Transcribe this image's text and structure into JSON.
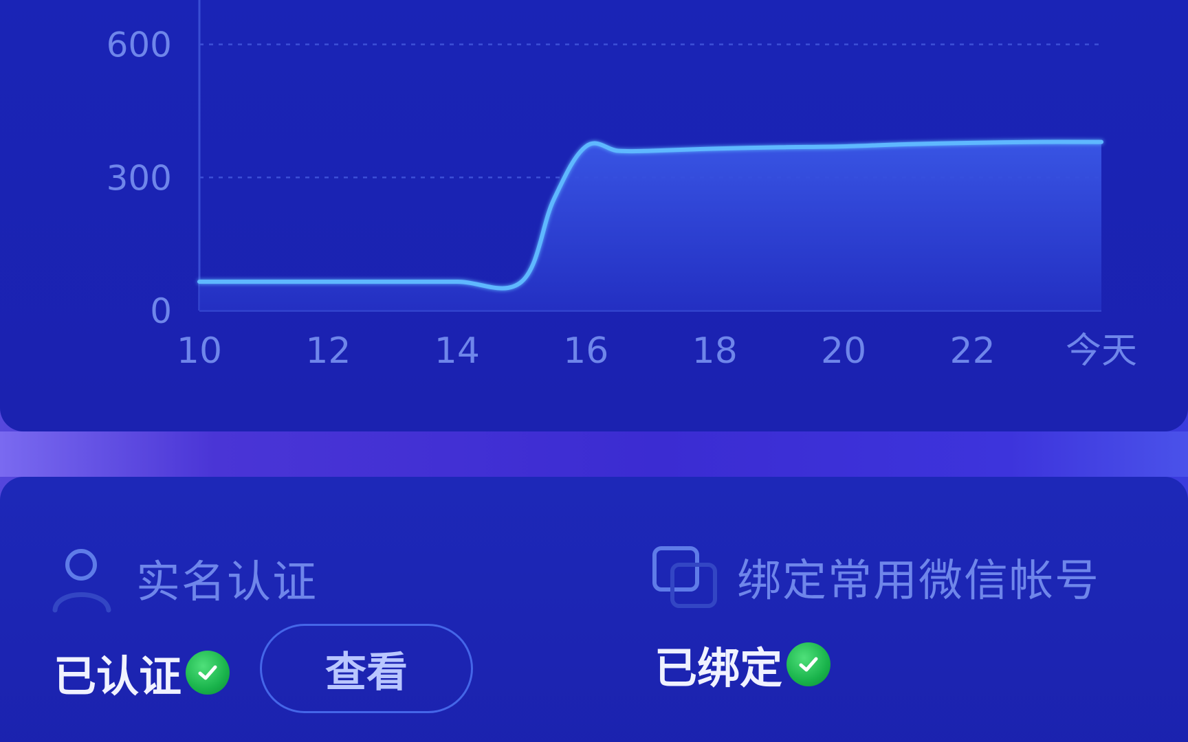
{
  "chart_data": {
    "type": "area",
    "x_labels": [
      "10",
      "12",
      "14",
      "16",
      "18",
      "20",
      "22",
      "今天"
    ],
    "y_ticks": [
      0,
      300,
      600
    ],
    "ylim": [
      0,
      700
    ],
    "x": [
      10,
      11,
      12,
      13,
      14,
      15,
      15.5,
      16,
      16.5,
      17,
      18,
      19,
      20,
      21,
      22,
      23,
      24
    ],
    "values": [
      65,
      65,
      65,
      65,
      65,
      65,
      250,
      370,
      360,
      360,
      365,
      368,
      370,
      375,
      378,
      380,
      380
    ],
    "grid": "dashed horizontal at 300 and 600",
    "colors": {
      "line": "#5fb8ff",
      "fill_top": "#3a57e6",
      "fill_bottom": "#2431c4",
      "axis_text": "#6f86ea"
    }
  },
  "identity": {
    "title": "实名认证",
    "icon": "user-icon",
    "status": "已认证",
    "view_label": "查看"
  },
  "wechat": {
    "title": "绑定常用微信帐号",
    "icon": "link-square-icon",
    "status": "已绑定"
  }
}
